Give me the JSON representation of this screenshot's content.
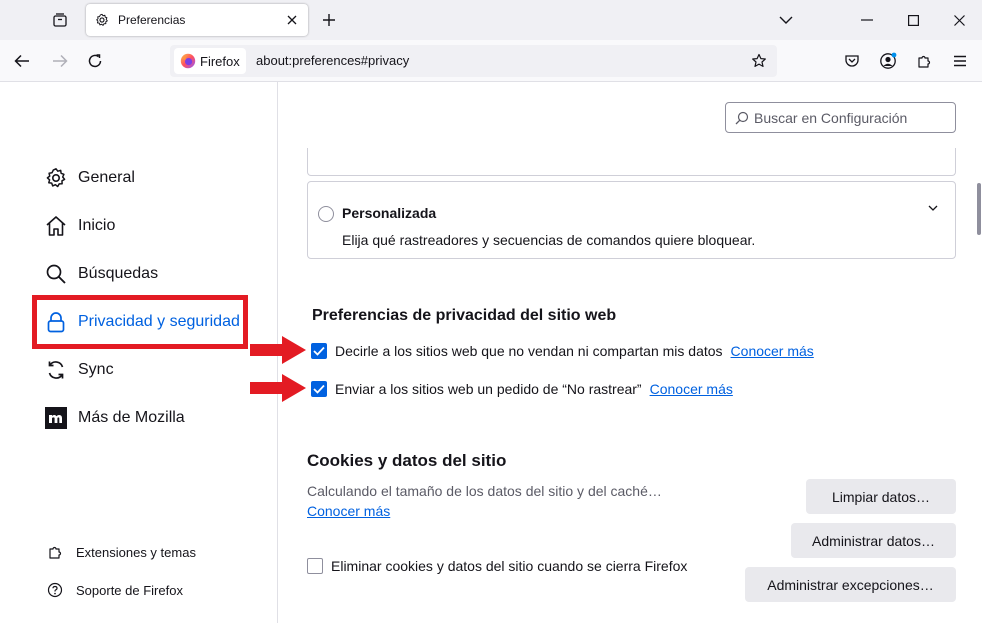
{
  "tab": {
    "title": "Preferencias"
  },
  "urlbar": {
    "identity_label": "Firefox",
    "url": "about:preferences#privacy"
  },
  "sidebar": {
    "categories": [
      {
        "label": "General",
        "icon": "gear-icon"
      },
      {
        "label": "Inicio",
        "icon": "home-icon"
      },
      {
        "label": "Búsquedas",
        "icon": "search-icon"
      },
      {
        "label": "Privacidad y seguridad",
        "icon": "lock-icon",
        "selected": true
      },
      {
        "label": "Sync",
        "icon": "sync-icon"
      },
      {
        "label": "Más de Mozilla",
        "icon": "mozilla-icon"
      }
    ],
    "footer": [
      {
        "label": "Extensiones y temas",
        "icon": "puzzle-icon"
      },
      {
        "label": "Soporte de Firefox",
        "icon": "help-icon"
      }
    ]
  },
  "search": {
    "placeholder": "Buscar en Configuración"
  },
  "tracking": {
    "custom_title": "Personalizada",
    "custom_desc": "Elija qué rastreadores y secuencias de comandos quiere bloquear."
  },
  "privacy_prefs": {
    "heading": "Preferencias de privacidad del sitio web",
    "items": [
      {
        "label": "Decirle a los sitios web que no vendan ni compartan mis datos",
        "link": "Conocer más",
        "checked": true
      },
      {
        "label": "Enviar a los sitios web un pedido de “No rastrear”",
        "link": "Conocer más",
        "checked": true
      }
    ]
  },
  "cookies": {
    "heading": "Cookies y datos del sitio",
    "calculating": "Calculando el tamaño de los datos del sitio y del caché…",
    "learn_more": "Conocer más",
    "clear_button": "Limpiar datos…",
    "manage_button": "Administrar datos…",
    "exceptions_button": "Administrar excepciones…",
    "delete_on_close": "Eliminar cookies y datos del sitio cuando se cierra Firefox",
    "delete_on_close_checked": false
  },
  "colors": {
    "accent": "#0061e0",
    "highlight": "#e31b23"
  }
}
